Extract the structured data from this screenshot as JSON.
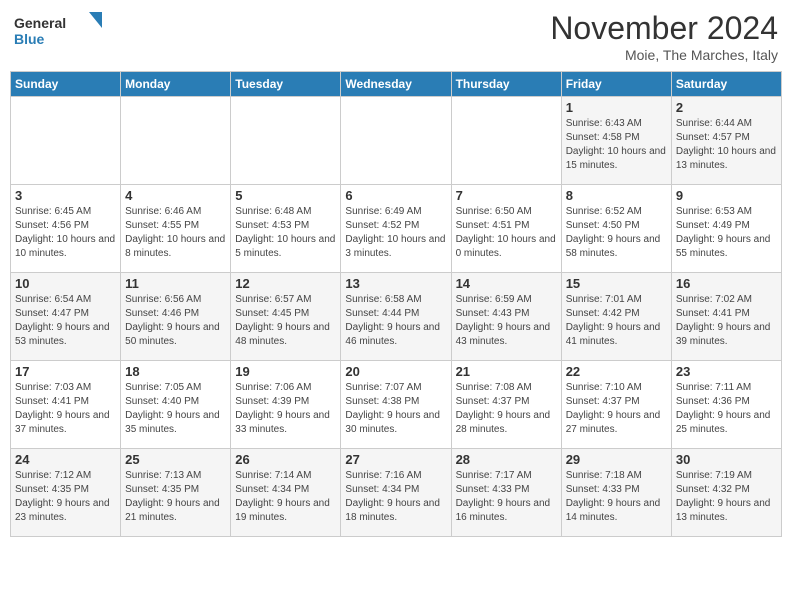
{
  "header": {
    "logo_general": "General",
    "logo_blue": "Blue",
    "month_title": "November 2024",
    "location": "Moie, The Marches, Italy"
  },
  "days_of_week": [
    "Sunday",
    "Monday",
    "Tuesday",
    "Wednesday",
    "Thursday",
    "Friday",
    "Saturday"
  ],
  "weeks": [
    [
      {
        "day": "",
        "info": ""
      },
      {
        "day": "",
        "info": ""
      },
      {
        "day": "",
        "info": ""
      },
      {
        "day": "",
        "info": ""
      },
      {
        "day": "",
        "info": ""
      },
      {
        "day": "1",
        "info": "Sunrise: 6:43 AM\nSunset: 4:58 PM\nDaylight: 10 hours and 15 minutes."
      },
      {
        "day": "2",
        "info": "Sunrise: 6:44 AM\nSunset: 4:57 PM\nDaylight: 10 hours and 13 minutes."
      }
    ],
    [
      {
        "day": "3",
        "info": "Sunrise: 6:45 AM\nSunset: 4:56 PM\nDaylight: 10 hours and 10 minutes."
      },
      {
        "day": "4",
        "info": "Sunrise: 6:46 AM\nSunset: 4:55 PM\nDaylight: 10 hours and 8 minutes."
      },
      {
        "day": "5",
        "info": "Sunrise: 6:48 AM\nSunset: 4:53 PM\nDaylight: 10 hours and 5 minutes."
      },
      {
        "day": "6",
        "info": "Sunrise: 6:49 AM\nSunset: 4:52 PM\nDaylight: 10 hours and 3 minutes."
      },
      {
        "day": "7",
        "info": "Sunrise: 6:50 AM\nSunset: 4:51 PM\nDaylight: 10 hours and 0 minutes."
      },
      {
        "day": "8",
        "info": "Sunrise: 6:52 AM\nSunset: 4:50 PM\nDaylight: 9 hours and 58 minutes."
      },
      {
        "day": "9",
        "info": "Sunrise: 6:53 AM\nSunset: 4:49 PM\nDaylight: 9 hours and 55 minutes."
      }
    ],
    [
      {
        "day": "10",
        "info": "Sunrise: 6:54 AM\nSunset: 4:47 PM\nDaylight: 9 hours and 53 minutes."
      },
      {
        "day": "11",
        "info": "Sunrise: 6:56 AM\nSunset: 4:46 PM\nDaylight: 9 hours and 50 minutes."
      },
      {
        "day": "12",
        "info": "Sunrise: 6:57 AM\nSunset: 4:45 PM\nDaylight: 9 hours and 48 minutes."
      },
      {
        "day": "13",
        "info": "Sunrise: 6:58 AM\nSunset: 4:44 PM\nDaylight: 9 hours and 46 minutes."
      },
      {
        "day": "14",
        "info": "Sunrise: 6:59 AM\nSunset: 4:43 PM\nDaylight: 9 hours and 43 minutes."
      },
      {
        "day": "15",
        "info": "Sunrise: 7:01 AM\nSunset: 4:42 PM\nDaylight: 9 hours and 41 minutes."
      },
      {
        "day": "16",
        "info": "Sunrise: 7:02 AM\nSunset: 4:41 PM\nDaylight: 9 hours and 39 minutes."
      }
    ],
    [
      {
        "day": "17",
        "info": "Sunrise: 7:03 AM\nSunset: 4:41 PM\nDaylight: 9 hours and 37 minutes."
      },
      {
        "day": "18",
        "info": "Sunrise: 7:05 AM\nSunset: 4:40 PM\nDaylight: 9 hours and 35 minutes."
      },
      {
        "day": "19",
        "info": "Sunrise: 7:06 AM\nSunset: 4:39 PM\nDaylight: 9 hours and 33 minutes."
      },
      {
        "day": "20",
        "info": "Sunrise: 7:07 AM\nSunset: 4:38 PM\nDaylight: 9 hours and 30 minutes."
      },
      {
        "day": "21",
        "info": "Sunrise: 7:08 AM\nSunset: 4:37 PM\nDaylight: 9 hours and 28 minutes."
      },
      {
        "day": "22",
        "info": "Sunrise: 7:10 AM\nSunset: 4:37 PM\nDaylight: 9 hours and 27 minutes."
      },
      {
        "day": "23",
        "info": "Sunrise: 7:11 AM\nSunset: 4:36 PM\nDaylight: 9 hours and 25 minutes."
      }
    ],
    [
      {
        "day": "24",
        "info": "Sunrise: 7:12 AM\nSunset: 4:35 PM\nDaylight: 9 hours and 23 minutes."
      },
      {
        "day": "25",
        "info": "Sunrise: 7:13 AM\nSunset: 4:35 PM\nDaylight: 9 hours and 21 minutes."
      },
      {
        "day": "26",
        "info": "Sunrise: 7:14 AM\nSunset: 4:34 PM\nDaylight: 9 hours and 19 minutes."
      },
      {
        "day": "27",
        "info": "Sunrise: 7:16 AM\nSunset: 4:34 PM\nDaylight: 9 hours and 18 minutes."
      },
      {
        "day": "28",
        "info": "Sunrise: 7:17 AM\nSunset: 4:33 PM\nDaylight: 9 hours and 16 minutes."
      },
      {
        "day": "29",
        "info": "Sunrise: 7:18 AM\nSunset: 4:33 PM\nDaylight: 9 hours and 14 minutes."
      },
      {
        "day": "30",
        "info": "Sunrise: 7:19 AM\nSunset: 4:32 PM\nDaylight: 9 hours and 13 minutes."
      }
    ]
  ]
}
